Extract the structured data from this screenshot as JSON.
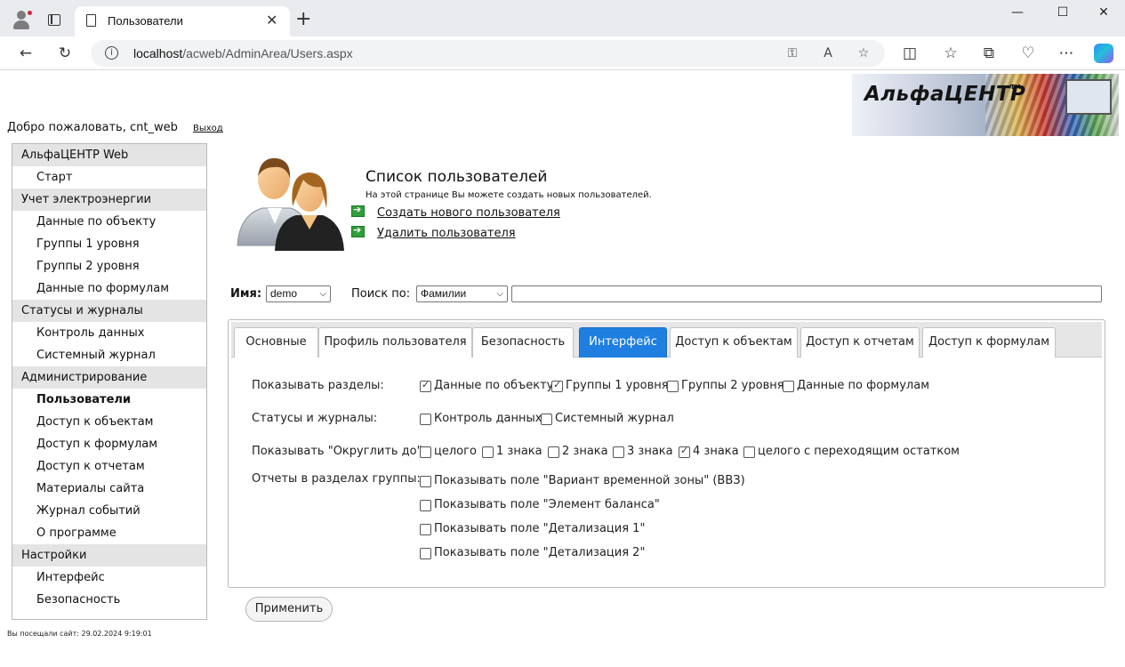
{
  "browser": {
    "tab_title": "Пользователи",
    "url_host": "localhost",
    "url_path": "/acweb/AdminArea/Users.aspx",
    "icons": [
      "profile-icon",
      "tab-actions-icon",
      "page-icon",
      "close-icon",
      "new-tab-icon",
      "minimize-icon",
      "maximize-icon",
      "close-window-icon",
      "back-icon",
      "refresh-icon",
      "info-icon",
      "key-icon",
      "read-aloud-icon",
      "favorite-icon",
      "split-screen-icon",
      "favorites-icon",
      "collections-icon",
      "health-icon",
      "more-icon",
      "copilot-icon"
    ]
  },
  "header": {
    "welcome": "Добро пожаловать, cnt_web",
    "logout": "Выход",
    "logo_text": "АльфаЦЕНТР",
    "logo_tm": "TM"
  },
  "sidebar": {
    "items": [
      {
        "label": "АльфаЦЕНТР Web",
        "type": "head"
      },
      {
        "label": "Старт",
        "type": "item"
      },
      {
        "label": "Учет электроэнергии",
        "type": "head"
      },
      {
        "label": "Данные по объекту",
        "type": "item"
      },
      {
        "label": "Группы 1 уровня",
        "type": "item"
      },
      {
        "label": "Группы 2 уровня",
        "type": "item"
      },
      {
        "label": "Данные по формулам",
        "type": "item"
      },
      {
        "label": "Статусы и журналы",
        "type": "head"
      },
      {
        "label": "Контроль данных",
        "type": "item"
      },
      {
        "label": "Системный журнал",
        "type": "item"
      },
      {
        "label": "Администрирование",
        "type": "head"
      },
      {
        "label": "Пользователи",
        "type": "item",
        "active": true
      },
      {
        "label": "Доступ к объектам",
        "type": "item"
      },
      {
        "label": "Доступ к формулам",
        "type": "item"
      },
      {
        "label": "Доступ к отчетам",
        "type": "item"
      },
      {
        "label": "Материалы сайта",
        "type": "item"
      },
      {
        "label": "Журнал событий",
        "type": "item"
      },
      {
        "label": "О программе",
        "type": "item"
      },
      {
        "label": "Настройки",
        "type": "head"
      },
      {
        "label": "Интерфейс",
        "type": "item"
      },
      {
        "label": "Безопасность",
        "type": "item"
      }
    ],
    "visited": "Вы посещали сайт: 29.02.2024 9:19:01"
  },
  "main": {
    "title": "Список пользователей",
    "description": "На этой странице Вы можете создать новых пользователей.",
    "create_link": "Создать нового пользователя",
    "delete_link": "Удалить пользователя",
    "name_label": "Имя:",
    "name_value": "demo",
    "search_label": "Поиск по:",
    "search_by_value": "Фамилии",
    "search_text": ""
  },
  "tabs": [
    {
      "label": "Основные"
    },
    {
      "label": "Профиль пользователя"
    },
    {
      "label": "Безопасность"
    },
    {
      "label": "Интерфейс",
      "active": true
    },
    {
      "label": "Доступ к объектам"
    },
    {
      "label": "Доступ к отчетам"
    },
    {
      "label": "Доступ к формулам"
    }
  ],
  "interface": {
    "sections_label": "Показывать разделы:",
    "sections": [
      {
        "label": "Данные по объекту",
        "checked": true
      },
      {
        "label": "Группы 1 уровня",
        "checked": true
      },
      {
        "label": "Группы 2 уровня",
        "checked": false
      },
      {
        "label": "Данные по формулам",
        "checked": false
      }
    ],
    "statuses_label": "Статусы и журналы:",
    "statuses": [
      {
        "label": "Контроль данных",
        "checked": false
      },
      {
        "label": "Системный журнал",
        "checked": false
      }
    ],
    "round_label": "Показывать \"Округлить до\":",
    "round": [
      {
        "label": "целого",
        "checked": false
      },
      {
        "label": "1 знака",
        "checked": false
      },
      {
        "label": "2 знака",
        "checked": false
      },
      {
        "label": "3 знака",
        "checked": false
      },
      {
        "label": "4 знака",
        "checked": true
      },
      {
        "label": "целого с переходящим остатком",
        "checked": false
      }
    ],
    "reports_label": "Отчеты в разделах группы:",
    "reports": [
      {
        "label": "Показывать поле \"Вариант временной зоны\" (ВВЗ)",
        "checked": false
      },
      {
        "label": "Показывать поле \"Элемент баланса\"",
        "checked": false
      },
      {
        "label": "Показывать поле \"Детализация 1\"",
        "checked": false
      },
      {
        "label": "Показывать поле \"Детализация 2\"",
        "checked": false
      }
    ],
    "apply": "Применить"
  },
  "colors": {
    "active_tab": "#1e7fe0",
    "sidebar_head": "#e4e4e4",
    "link_arrow": "#2f9e3b"
  }
}
